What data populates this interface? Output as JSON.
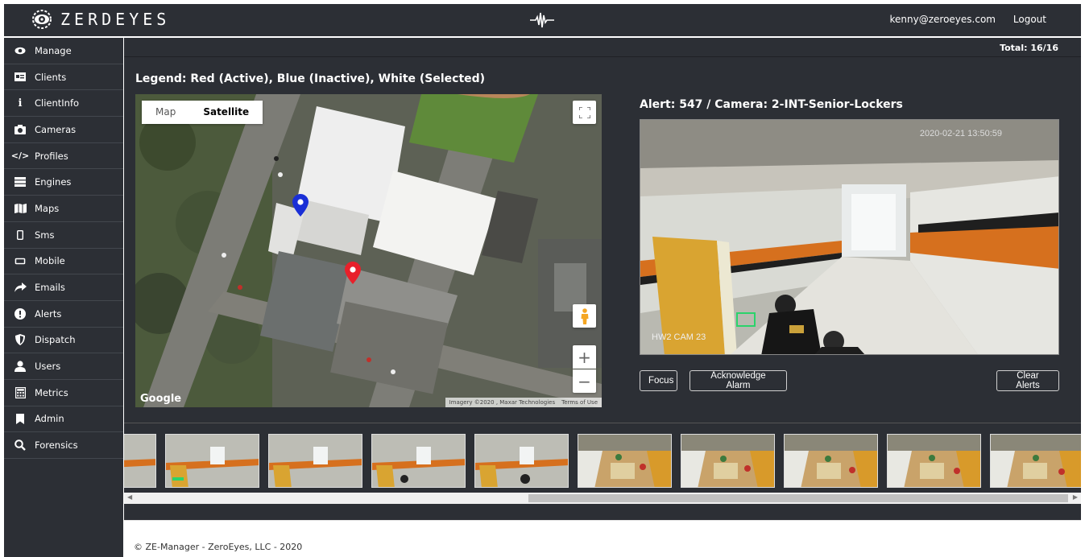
{
  "header": {
    "brand": "ZERDEYES",
    "user_email": "kenny@zeroeyes.com",
    "logout_label": "Logout"
  },
  "sidebar": {
    "items": [
      {
        "label": "Manage",
        "icon": "eye-icon"
      },
      {
        "label": "Clients",
        "icon": "id-card-icon"
      },
      {
        "label": "ClientInfo",
        "icon": "info-icon"
      },
      {
        "label": "Cameras",
        "icon": "camera-icon"
      },
      {
        "label": "Profiles",
        "icon": "code-icon"
      },
      {
        "label": "Engines",
        "icon": "server-icon"
      },
      {
        "label": "Maps",
        "icon": "map-icon"
      },
      {
        "label": "Sms",
        "icon": "phone-icon"
      },
      {
        "label": "Mobile",
        "icon": "tablet-icon"
      },
      {
        "label": "Emails",
        "icon": "share-arrow-icon"
      },
      {
        "label": "Alerts",
        "icon": "exclamation-circle-icon"
      },
      {
        "label": "Dispatch",
        "icon": "shield-icon"
      },
      {
        "label": "Users",
        "icon": "user-icon"
      },
      {
        "label": "Metrics",
        "icon": "calculator-icon"
      },
      {
        "label": "Admin",
        "icon": "bookmark-icon"
      },
      {
        "label": "Forensics",
        "icon": "search-icon"
      }
    ]
  },
  "main": {
    "total": "Total: 16/16",
    "legend": "Legend: Red (Active), Blue (Inactive), White (Selected)",
    "map": {
      "tabs": [
        "Map",
        "Satellite"
      ],
      "active_tab": "Satellite",
      "zoom_in": "+",
      "zoom_out": "−",
      "google": "Google",
      "attribution": "Imagery ©2020 , Maxar Technologies",
      "terms": "Terms of Use",
      "markers": [
        {
          "status": "Inactive",
          "color": "#1a2fd6"
        },
        {
          "status": "Active",
          "color": "#e8202a"
        }
      ]
    },
    "alert": {
      "title": "Alert: 547 / Camera: 2-INT-Senior-Lockers",
      "timestamp": "2020-02-21 13:50:59",
      "camera_label": "HW2 CAM 23",
      "focus_label": "Focus",
      "acknowledge_label": "Acknowledge Alarm",
      "clear_label": "Clear Alerts"
    }
  },
  "footer": {
    "text": "© ZE-Manager - ZeroEyes, LLC - 2020"
  },
  "colors": {
    "panel": "#2c2f35",
    "active_marker": "#e8202a",
    "inactive_marker": "#1a2fd6"
  }
}
